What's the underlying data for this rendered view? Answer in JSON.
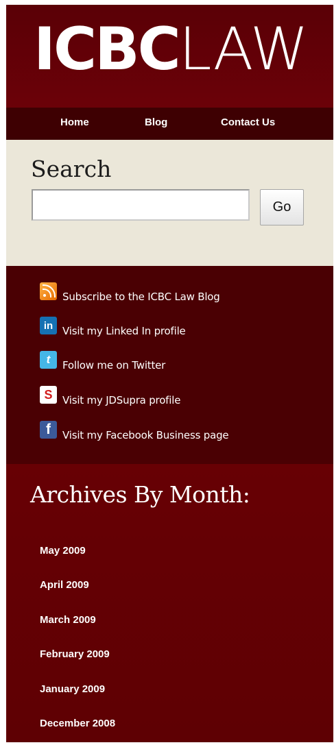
{
  "logo": {
    "bold": "ICBC",
    "light": "LAW"
  },
  "nav": [
    "Home",
    "Blog",
    "Contact Us"
  ],
  "search": {
    "title": "Search",
    "value": "",
    "button": "Go"
  },
  "social": [
    {
      "icon": "rss-icon",
      "glyph": "",
      "label": "Subscribe to the ICBC Law Blog"
    },
    {
      "icon": "linkedin-icon",
      "glyph": "in",
      "label": "Visit my Linked In profile"
    },
    {
      "icon": "twitter-icon",
      "glyph": "t",
      "label": "Follow me on Twitter"
    },
    {
      "icon": "jdsupra-icon",
      "glyph": "S",
      "label": "Visit my JDSupra profile"
    },
    {
      "icon": "facebook-icon",
      "glyph": "f",
      "label": "Visit my Facebook Business page"
    }
  ],
  "archives": {
    "title": "Archives By Month:",
    "items": [
      "May 2009",
      "April 2009",
      "March 2009",
      "February 2009",
      "January 2009",
      "December 2008"
    ]
  },
  "colors": {
    "maroon_dark": "#4a0003",
    "maroon": "#670004",
    "nav": "#3e0002",
    "search_bg": "#ebe7d9"
  }
}
